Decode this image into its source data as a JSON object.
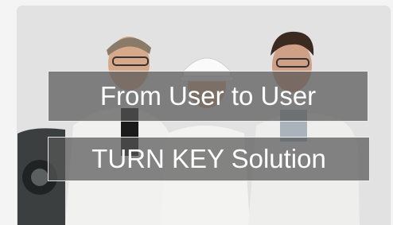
{
  "banner": {
    "headline": "From User to User",
    "subheadline": "TURN KEY Solution"
  },
  "colors": {
    "overlay_background": "#585858",
    "overlay_text": "#ffffff",
    "page_background": "#f4f4f4"
  }
}
